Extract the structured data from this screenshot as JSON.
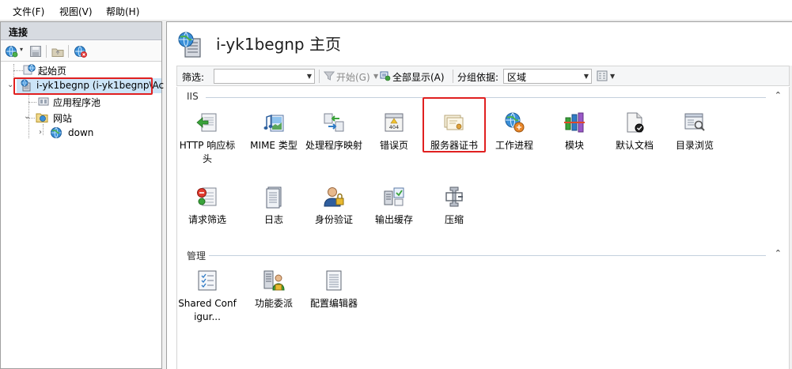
{
  "menu": [
    "文件(F)",
    "视图(V)",
    "帮助(H)"
  ],
  "connections": {
    "header": "连接",
    "tree": {
      "start_page": "起始页",
      "server": "i-yk1begnp (i-yk1begnp\\Ac",
      "app_pools": "应用程序池",
      "sites": "网站",
      "site_down": "down"
    }
  },
  "main": {
    "title": "i-yk1begnp 主页",
    "filter": {
      "filter_label": "筛选:",
      "go_label": "开始(G)",
      "show_all_label": "全部显示(A)",
      "group_by_label": "分组依据:",
      "group_by_value": "区域"
    },
    "groups": [
      {
        "name": "IIS",
        "features": [
          "HTTP 响应标头",
          "MIME 类型",
          "处理程序映射",
          "错误页",
          "服务器证书",
          "工作进程",
          "模块",
          "默认文档",
          "目录浏览",
          "请求筛选",
          "日志",
          "身份验证",
          "输出缓存",
          "压缩"
        ]
      },
      {
        "name": "管理",
        "features": [
          "Shared Configur...",
          "功能委派",
          "配置编辑器"
        ]
      }
    ]
  },
  "colors": {
    "highlight": "#e02020",
    "header_bg": "#d7dbe1",
    "group_line": "#c4d0dd"
  }
}
